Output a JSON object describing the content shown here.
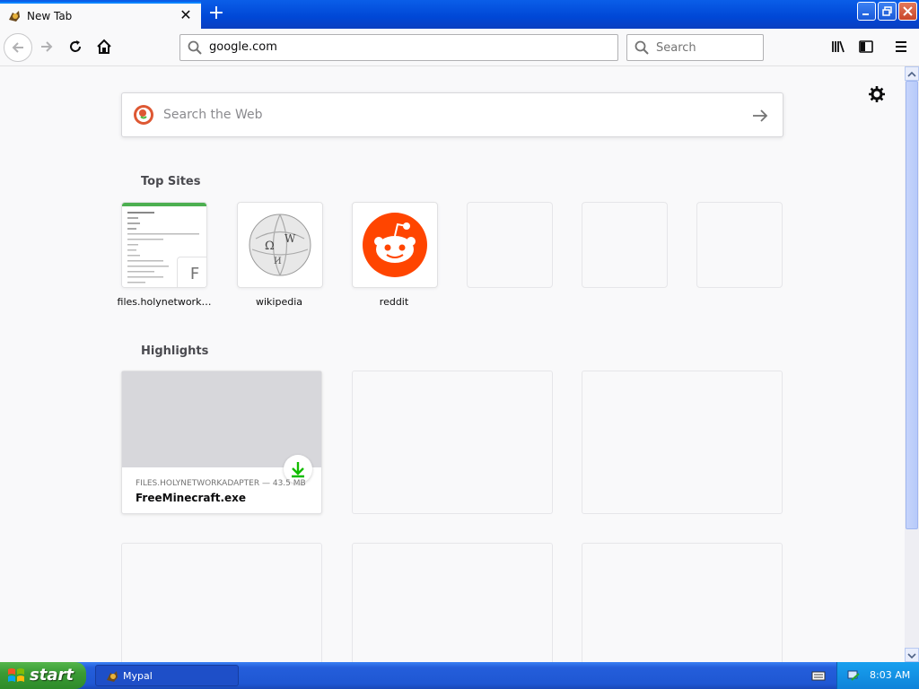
{
  "tab": {
    "title": "New Tab",
    "close": "✕"
  },
  "toolbar": {
    "url": "google.com",
    "search_placeholder": "Search"
  },
  "newtab": {
    "search_placeholder": "Search the Web",
    "top_sites_title": "Top Sites",
    "highlights_title": "Highlights",
    "top_sites": [
      {
        "label": "files.holynetwork…",
        "badge": "F"
      },
      {
        "label": "wikipedia"
      },
      {
        "label": "reddit"
      }
    ],
    "highlight": {
      "context": "FILES.HOLYNETWORKADAPTER — 43.5 MB",
      "title": "FreeMinecraft.exe"
    }
  },
  "taskbar": {
    "start_label": "start",
    "task_label": "Mypal",
    "clock": "8:03 AM"
  },
  "colors": {
    "accent": "#0a84ff",
    "reddit": "#ff4500",
    "download": "#12bc00"
  }
}
